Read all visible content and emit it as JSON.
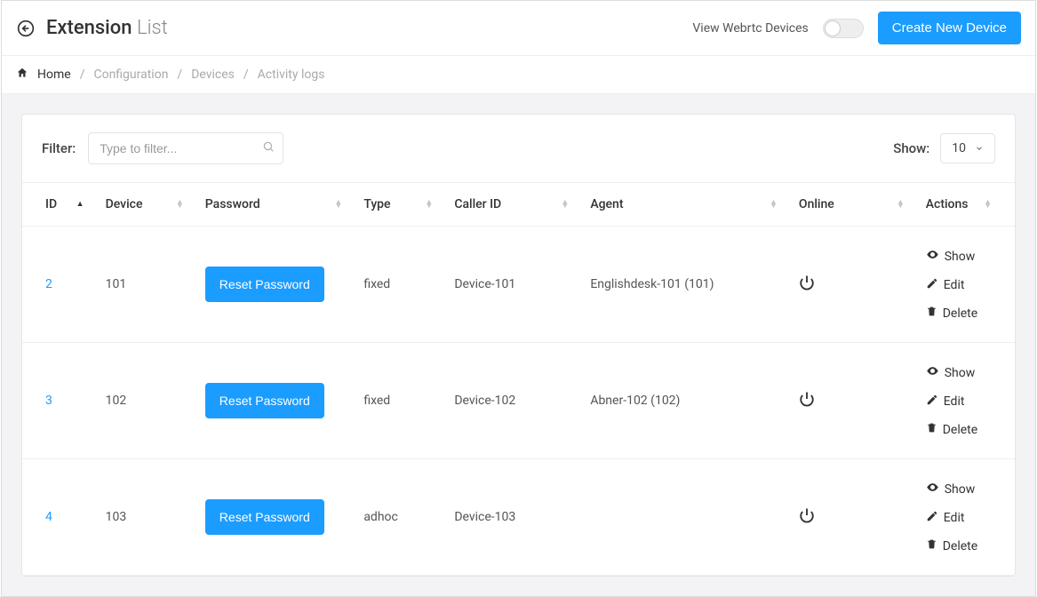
{
  "header": {
    "title_main": "Extension",
    "title_sub": "List",
    "webrtc_label": "View Webrtc Devices",
    "create_btn": "Create New Device"
  },
  "breadcrumb": {
    "home": "Home",
    "configuration": "Configuration",
    "devices": "Devices",
    "activity_logs": "Activity logs"
  },
  "filter": {
    "label": "Filter:",
    "placeholder": "Type to filter...",
    "show_label": "Show:",
    "show_value": "10"
  },
  "columns": {
    "id": "ID",
    "device": "Device",
    "password": "Password",
    "type": "Type",
    "caller_id": "Caller ID",
    "agent": "Agent",
    "online": "Online",
    "actions": "Actions"
  },
  "rows": [
    {
      "id": "2",
      "device": "101",
      "password_btn": "Reset Password",
      "type": "fixed",
      "caller_id": "Device-101",
      "agent": "Englishdesk-101 (101)"
    },
    {
      "id": "3",
      "device": "102",
      "password_btn": "Reset Password",
      "type": "fixed",
      "caller_id": "Device-102",
      "agent": "Abner-102 (102)"
    },
    {
      "id": "4",
      "device": "103",
      "password_btn": "Reset Password",
      "type": "adhoc",
      "caller_id": "Device-103",
      "agent": ""
    }
  ],
  "actions": {
    "show": "Show",
    "edit": "Edit",
    "delete": "Delete"
  }
}
